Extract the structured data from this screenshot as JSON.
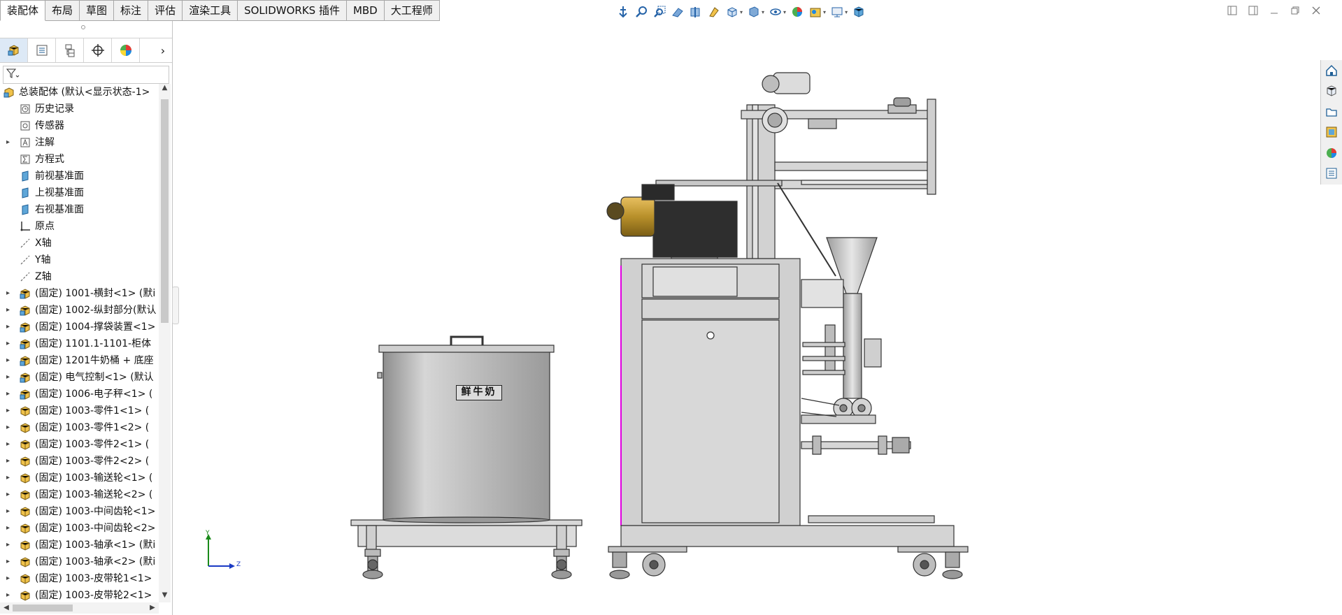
{
  "ribbon": {
    "tabs": [
      {
        "label": "装配体"
      },
      {
        "label": "布局"
      },
      {
        "label": "草图"
      },
      {
        "label": "标注"
      },
      {
        "label": "评估"
      },
      {
        "label": "渲染工具"
      },
      {
        "label": "SOLIDWORKS 插件"
      },
      {
        "label": "MBD"
      },
      {
        "label": "大工程师"
      }
    ],
    "active_tab": "装配体"
  },
  "view_toolbar": {
    "icons": [
      "view-orientation-anchor-icon",
      "zoom-to-fit-icon",
      "zoom-to-area-icon",
      "previous-view-icon",
      "section-view-icon",
      "dynamic-annotation-icon",
      "view-orientation-icon",
      "display-style-icon",
      "hide-show-items-icon",
      "edit-appearance-icon",
      "apply-scene-icon",
      "view-settings-icon",
      "3d-view-icon"
    ]
  },
  "feature_tree": {
    "filter_icon": "filter-icon",
    "panel_tabs": [
      "featuremanager-icon",
      "propertymanager-icon",
      "configurationmanager-icon",
      "dimxpert-icon",
      "displaymanager-icon"
    ],
    "root": "总装配体 (默认<显示状态-1>",
    "items": [
      {
        "label": "历史记录",
        "icon": "history-icon",
        "expandable": false
      },
      {
        "label": "传感器",
        "icon": "sensor-icon",
        "expandable": false
      },
      {
        "label": "注解",
        "icon": "annotation-icon",
        "expandable": true
      },
      {
        "label": "方程式",
        "icon": "equation-icon",
        "expandable": false
      },
      {
        "label": "前视基准面",
        "icon": "plane-icon",
        "expandable": false
      },
      {
        "label": "上视基准面",
        "icon": "plane-icon",
        "expandable": false
      },
      {
        "label": "右视基准面",
        "icon": "plane-icon",
        "expandable": false
      },
      {
        "label": "原点",
        "icon": "origin-icon",
        "expandable": false
      },
      {
        "label": "X轴",
        "icon": "axis-icon",
        "expandable": false
      },
      {
        "label": "Y轴",
        "icon": "axis-icon",
        "expandable": false
      },
      {
        "label": "Z轴",
        "icon": "axis-icon",
        "expandable": false
      },
      {
        "label": "(固定) 1001-横封<1> (默i",
        "icon": "subassembly-icon",
        "expandable": true
      },
      {
        "label": "(固定) 1002-纵封部分(默认",
        "icon": "subassembly-icon",
        "expandable": true
      },
      {
        "label": "(固定) 1004-撑袋装置<1>",
        "icon": "subassembly-icon",
        "expandable": true
      },
      {
        "label": "(固定) 1101.1-1101-柜体",
        "icon": "subassembly-icon",
        "expandable": true
      },
      {
        "label": "(固定) 1201牛奶桶 + 底座",
        "icon": "subassembly-icon",
        "expandable": true
      },
      {
        "label": "(固定) 电气控制<1> (默认",
        "icon": "subassembly-icon",
        "expandable": true
      },
      {
        "label": "(固定) 1006-电子秤<1> (",
        "icon": "subassembly-icon",
        "expandable": true
      },
      {
        "label": "(固定) 1003-零件1<1> (",
        "icon": "part-icon",
        "expandable": true
      },
      {
        "label": "(固定) 1003-零件1<2> (",
        "icon": "part-icon",
        "expandable": true
      },
      {
        "label": "(固定) 1003-零件2<1> (",
        "icon": "part-icon",
        "expandable": true
      },
      {
        "label": "(固定) 1003-零件2<2> (",
        "icon": "part-icon",
        "expandable": true
      },
      {
        "label": "(固定) 1003-输送轮<1> (",
        "icon": "part-icon",
        "expandable": true
      },
      {
        "label": "(固定) 1003-输送轮<2> (",
        "icon": "part-icon",
        "expandable": true
      },
      {
        "label": "(固定) 1003-中间齿轮<1>",
        "icon": "part-icon",
        "expandable": true
      },
      {
        "label": "(固定) 1003-中间齿轮<2>",
        "icon": "part-icon",
        "expandable": true
      },
      {
        "label": "(固定) 1003-轴承<1> (默i",
        "icon": "part-icon",
        "expandable": true
      },
      {
        "label": "(固定) 1003-轴承<2> (默i",
        "icon": "part-icon",
        "expandable": true
      },
      {
        "label": "(固定) 1003-皮带轮1<1>",
        "icon": "part-icon",
        "expandable": true
      },
      {
        "label": "(固定) 1003-皮带轮2<1>",
        "icon": "part-icon",
        "expandable": true
      }
    ]
  },
  "task_pane": {
    "icons": [
      "solidworks-resources-icon",
      "design-library-icon",
      "file-explorer-icon",
      "view-palette-icon",
      "appearances-icon",
      "custom-properties-icon"
    ]
  },
  "model": {
    "tank_label": "鲜牛奶"
  },
  "triad": {
    "y_label": "Y",
    "z_label": "Z"
  },
  "colors": {
    "ribbon_bg": "#f0f0f0",
    "selection": "#dde9f6",
    "model_gray": "#c8c8c8",
    "sketch_magenta": "#e000e0",
    "motor_gold": "#b8902a"
  }
}
